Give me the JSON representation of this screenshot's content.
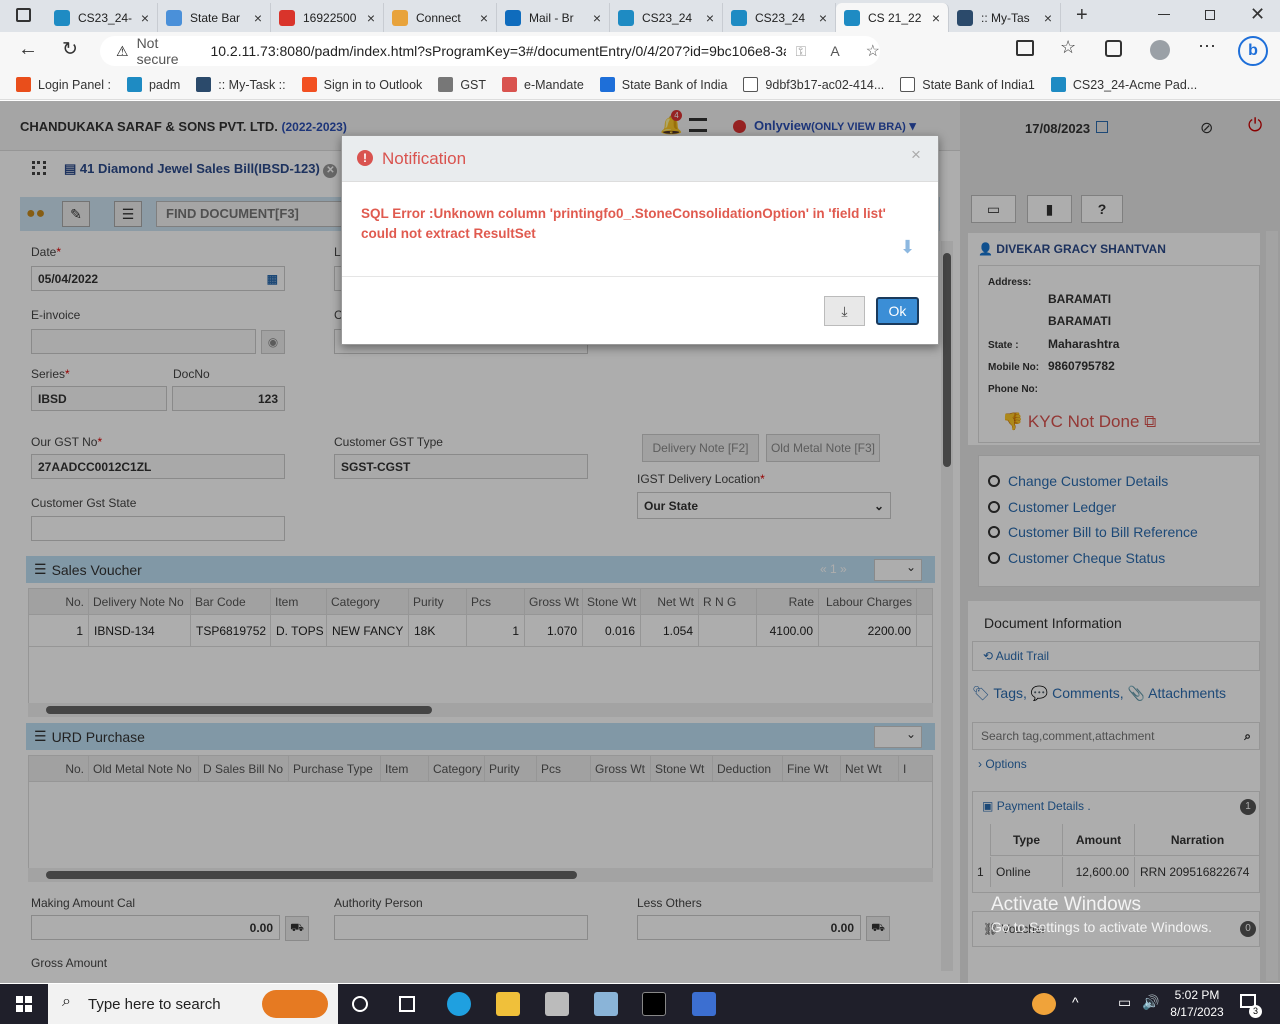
{
  "browser": {
    "tabs": [
      {
        "label": "CS23_24-",
        "color": "#1e8bc3"
      },
      {
        "label": "State Bar",
        "color": "#4a90d9"
      },
      {
        "label": "16922500",
        "color": "#d9342b"
      },
      {
        "label": "Connect",
        "color": "#e8a33b"
      },
      {
        "label": "Mail - Br",
        "color": "#0f6cbd"
      },
      {
        "label": "CS23_24",
        "color": "#1e8bc3"
      },
      {
        "label": "CS23_24",
        "color": "#1e8bc3"
      },
      {
        "label": "CS 21_22",
        "color": "#1e8bc3"
      },
      {
        "label": ":: My-Tas",
        "color": "#2b4a6b"
      }
    ],
    "security_label": "Not secure",
    "url": "10.2.11.73:8080/padm/index.html?sProgramKey=3#/documentEntry/0/4/207?id=9bc106e8-3ae9-4fef...",
    "bookmarks": [
      {
        "label": "Login Panel :",
        "color": "#e94e1b"
      },
      {
        "label": "padm",
        "color": "#1e8bc3"
      },
      {
        "label": ":: My-Task ::",
        "color": "#2b4a6b"
      },
      {
        "label": "Sign in to Outlook",
        "color": "#f25022"
      },
      {
        "label": "GST",
        "color": "#777777"
      },
      {
        "label": "e-Mandate",
        "color": "#d9534f"
      },
      {
        "label": "State Bank of India",
        "color": "#1e6fd9"
      },
      {
        "label": "9dbf3b17-ac02-414...",
        "color": "#ffffff"
      },
      {
        "label": "State Bank of India1",
        "color": "#ffffff"
      },
      {
        "label": "CS23_24-Acme Pad...",
        "color": "#1e8bc3"
      }
    ]
  },
  "app": {
    "company": "CHANDUKAKA SARAF & SONS PVT. LTD.",
    "year": "(2022-2023)",
    "notif_count": "4",
    "view_mode": "Onlyview",
    "view_mode_sub": "(ONLY VIEW BRA)",
    "date": "17/08/2023",
    "doc_title": "41 Diamond Jewel Sales Bill(IBSD-123)",
    "find_placeholder": "FIND DOCUMENT[F3]"
  },
  "form": {
    "date_label": "Date",
    "date_value": "05/04/2022",
    "einvoice_label": "E-invoice",
    "series_label": "Series",
    "series_value": "IBSD",
    "docno_label": "DocNo",
    "docno_value": "123",
    "gst_label": "Our GST No",
    "gst_value": "27AADCC0012C1ZL",
    "cust_gst_type_label": "Customer GST Type",
    "cust_gst_type_value": "SGST-CGST",
    "delivery_note_btn": "Delivery Note [F2]",
    "old_metal_btn": "Old Metal Note [F3]",
    "igst_label": "IGST Delivery Location",
    "igst_value": "Our State",
    "cust_gst_state_label": "Customer Gst State",
    "partial_label_l": "L",
    "partial_label_c": "C"
  },
  "sales_voucher": {
    "title": "Sales Voucher",
    "page": "1",
    "headers": [
      "No.",
      "Delivery Note No",
      "Bar Code",
      "Item",
      "Category",
      "Purity",
      "Pcs",
      "Gross Wt",
      "Stone Wt",
      "Net Wt",
      "R N G",
      "Rate",
      "Labour Charges"
    ],
    "rows": [
      [
        "1",
        "IBNSD-134",
        "TSP6819752",
        "D. TOPS",
        "NEW FANCY",
        "18K",
        "1",
        "1.070",
        "0.016",
        "1.054",
        "",
        "4100.00",
        "2200.00"
      ]
    ]
  },
  "urd": {
    "title": "URD Purchase",
    "headers": [
      "No.",
      "Old Metal Note No",
      "D Sales Bill No",
      "Purchase Type",
      "Item",
      "Category",
      "Purity",
      "Pcs",
      "Gross Wt",
      "Stone Wt",
      "Deduction",
      "Fine Wt",
      "Net Wt",
      "I"
    ]
  },
  "bottom": {
    "making_label": "Making Amount Cal",
    "making_value": "0.00",
    "authority_label": "Authority Person",
    "less_others_label": "Less Others",
    "less_others_value": "0.00",
    "gross_label": "Gross Amount"
  },
  "customer": {
    "name": "DIVEKAR GRACY SHANTVAN",
    "address_label": "Address:",
    "address1": "BARAMATI",
    "address2": "BARAMATI",
    "state_label": "State :",
    "state": "Maharashtra",
    "mobile_label": "Mobile No:",
    "mobile": "9860795782",
    "phone_label": "Phone No:",
    "kyc": "KYC Not Done",
    "links": [
      "Change Customer Details",
      "Customer Ledger",
      "Customer Bill to Bill Reference",
      "Customer Cheque Status"
    ]
  },
  "docinfo": {
    "title": "Document Information",
    "audit": "Audit Trail",
    "tags": "Tags,",
    "comments": "Comments,",
    "attachments": "Attachments",
    "search_placeholder": "Search tag,comment,attachment",
    "options": "Options",
    "payment_title": "Payment Details .",
    "payment_count": "1",
    "pay_headers": [
      "Type",
      "Amount",
      "Narration"
    ],
    "pay_rows": [
      [
        "1",
        "Online",
        "12,600.00",
        "RRN 209516822674"
      ]
    ],
    "bottom_item": "Voucher",
    "bottom_count": "0"
  },
  "watermark": {
    "line1": "Activate Windows",
    "line2": "Go to Settings to activate Windows."
  },
  "modal": {
    "title": "Notification",
    "message_line1": "SQL Error :Unknown column 'printingfo0_.StoneConsolidationOption' in 'field list'",
    "message_line2": "could not extract ResultSet",
    "ok": "Ok"
  },
  "taskbar": {
    "search_placeholder": "Type here to search",
    "time": "5:02 PM",
    "date": "8/17/2023",
    "notif_count": "3"
  }
}
